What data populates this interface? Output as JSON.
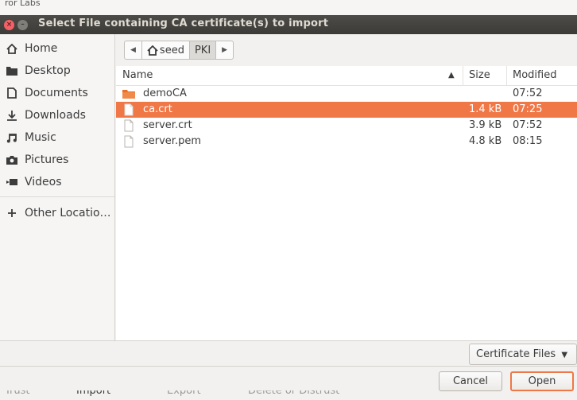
{
  "background": {
    "top_text": "ror Labs",
    "tabs": [
      "Trust",
      "Import",
      "Export",
      "Delete or Distrust"
    ]
  },
  "dialog": {
    "title": "Select File containing CA certificate(s) to import",
    "close_glyph": "×",
    "min_glyph": "–"
  },
  "sidebar": {
    "items": [
      {
        "label": "Home",
        "icon": "home-icon"
      },
      {
        "label": "Desktop",
        "icon": "desktop-icon"
      },
      {
        "label": "Documents",
        "icon": "documents-icon"
      },
      {
        "label": "Downloads",
        "icon": "downloads-icon"
      },
      {
        "label": "Music",
        "icon": "music-icon"
      },
      {
        "label": "Pictures",
        "icon": "pictures-icon"
      },
      {
        "label": "Videos",
        "icon": "videos-icon"
      }
    ],
    "other": {
      "label": "Other Locatio…",
      "icon": "plus-icon"
    }
  },
  "pathbar": {
    "back_glyph": "◀",
    "forward_glyph": "▶",
    "crumbs": [
      "seed",
      "PKI"
    ],
    "active": "PKI"
  },
  "columns": {
    "name": "Name",
    "sort_glyph": "▲",
    "size": "Size",
    "modified": "Modified"
  },
  "files": [
    {
      "name": "demoCA",
      "size": "",
      "modified": "07:52",
      "type": "folder",
      "selected": false
    },
    {
      "name": "ca.crt",
      "size": "1.4 kB",
      "modified": "07:25",
      "type": "file",
      "selected": true
    },
    {
      "name": "server.crt",
      "size": "3.9 kB",
      "modified": "07:52",
      "type": "file",
      "selected": false
    },
    {
      "name": "server.pem",
      "size": "4.8 kB",
      "modified": "08:15",
      "type": "file",
      "selected": false
    }
  ],
  "filter": {
    "label": "Certificate Files",
    "arrow": "▼"
  },
  "actions": {
    "cancel": "Cancel",
    "open": "Open"
  },
  "colors": {
    "accent": "#f07746",
    "titlebar": "#3c3b37",
    "folder": "#e8702a"
  }
}
